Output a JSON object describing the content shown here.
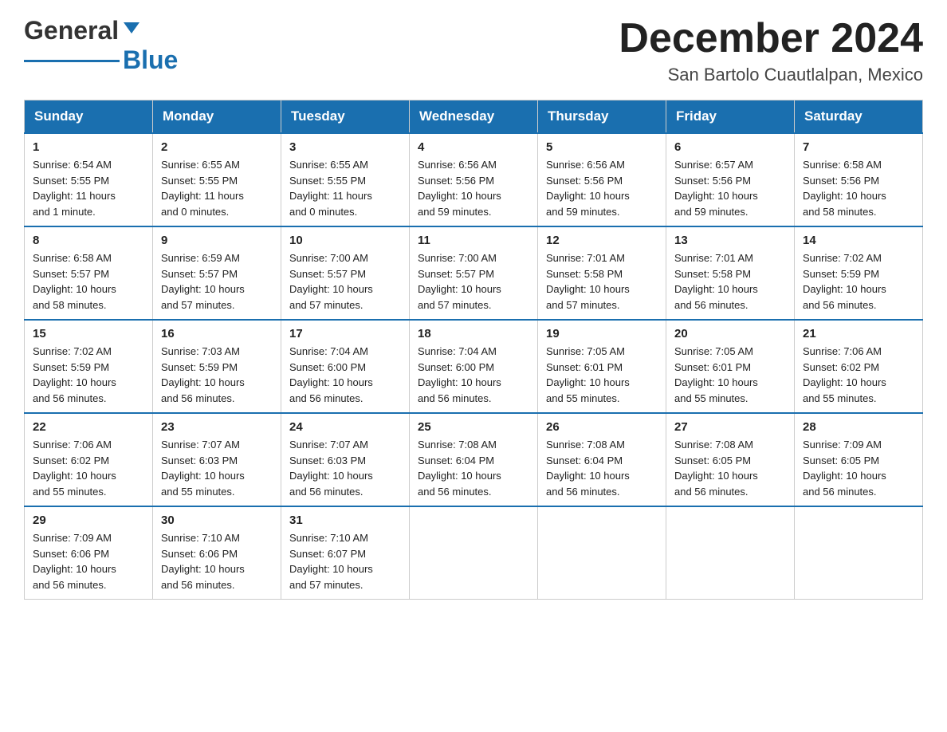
{
  "logo": {
    "general": "General",
    "blue": "Blue"
  },
  "title": {
    "month": "December 2024",
    "location": "San Bartolo Cuautlalpan, Mexico"
  },
  "headers": [
    "Sunday",
    "Monday",
    "Tuesday",
    "Wednesday",
    "Thursday",
    "Friday",
    "Saturday"
  ],
  "weeks": [
    [
      {
        "day": "1",
        "info": "Sunrise: 6:54 AM\nSunset: 5:55 PM\nDaylight: 11 hours\nand 1 minute."
      },
      {
        "day": "2",
        "info": "Sunrise: 6:55 AM\nSunset: 5:55 PM\nDaylight: 11 hours\nand 0 minutes."
      },
      {
        "day": "3",
        "info": "Sunrise: 6:55 AM\nSunset: 5:55 PM\nDaylight: 11 hours\nand 0 minutes."
      },
      {
        "day": "4",
        "info": "Sunrise: 6:56 AM\nSunset: 5:56 PM\nDaylight: 10 hours\nand 59 minutes."
      },
      {
        "day": "5",
        "info": "Sunrise: 6:56 AM\nSunset: 5:56 PM\nDaylight: 10 hours\nand 59 minutes."
      },
      {
        "day": "6",
        "info": "Sunrise: 6:57 AM\nSunset: 5:56 PM\nDaylight: 10 hours\nand 59 minutes."
      },
      {
        "day": "7",
        "info": "Sunrise: 6:58 AM\nSunset: 5:56 PM\nDaylight: 10 hours\nand 58 minutes."
      }
    ],
    [
      {
        "day": "8",
        "info": "Sunrise: 6:58 AM\nSunset: 5:57 PM\nDaylight: 10 hours\nand 58 minutes."
      },
      {
        "day": "9",
        "info": "Sunrise: 6:59 AM\nSunset: 5:57 PM\nDaylight: 10 hours\nand 57 minutes."
      },
      {
        "day": "10",
        "info": "Sunrise: 7:00 AM\nSunset: 5:57 PM\nDaylight: 10 hours\nand 57 minutes."
      },
      {
        "day": "11",
        "info": "Sunrise: 7:00 AM\nSunset: 5:57 PM\nDaylight: 10 hours\nand 57 minutes."
      },
      {
        "day": "12",
        "info": "Sunrise: 7:01 AM\nSunset: 5:58 PM\nDaylight: 10 hours\nand 57 minutes."
      },
      {
        "day": "13",
        "info": "Sunrise: 7:01 AM\nSunset: 5:58 PM\nDaylight: 10 hours\nand 56 minutes."
      },
      {
        "day": "14",
        "info": "Sunrise: 7:02 AM\nSunset: 5:59 PM\nDaylight: 10 hours\nand 56 minutes."
      }
    ],
    [
      {
        "day": "15",
        "info": "Sunrise: 7:02 AM\nSunset: 5:59 PM\nDaylight: 10 hours\nand 56 minutes."
      },
      {
        "day": "16",
        "info": "Sunrise: 7:03 AM\nSunset: 5:59 PM\nDaylight: 10 hours\nand 56 minutes."
      },
      {
        "day": "17",
        "info": "Sunrise: 7:04 AM\nSunset: 6:00 PM\nDaylight: 10 hours\nand 56 minutes."
      },
      {
        "day": "18",
        "info": "Sunrise: 7:04 AM\nSunset: 6:00 PM\nDaylight: 10 hours\nand 56 minutes."
      },
      {
        "day": "19",
        "info": "Sunrise: 7:05 AM\nSunset: 6:01 PM\nDaylight: 10 hours\nand 55 minutes."
      },
      {
        "day": "20",
        "info": "Sunrise: 7:05 AM\nSunset: 6:01 PM\nDaylight: 10 hours\nand 55 minutes."
      },
      {
        "day": "21",
        "info": "Sunrise: 7:06 AM\nSunset: 6:02 PM\nDaylight: 10 hours\nand 55 minutes."
      }
    ],
    [
      {
        "day": "22",
        "info": "Sunrise: 7:06 AM\nSunset: 6:02 PM\nDaylight: 10 hours\nand 55 minutes."
      },
      {
        "day": "23",
        "info": "Sunrise: 7:07 AM\nSunset: 6:03 PM\nDaylight: 10 hours\nand 55 minutes."
      },
      {
        "day": "24",
        "info": "Sunrise: 7:07 AM\nSunset: 6:03 PM\nDaylight: 10 hours\nand 56 minutes."
      },
      {
        "day": "25",
        "info": "Sunrise: 7:08 AM\nSunset: 6:04 PM\nDaylight: 10 hours\nand 56 minutes."
      },
      {
        "day": "26",
        "info": "Sunrise: 7:08 AM\nSunset: 6:04 PM\nDaylight: 10 hours\nand 56 minutes."
      },
      {
        "day": "27",
        "info": "Sunrise: 7:08 AM\nSunset: 6:05 PM\nDaylight: 10 hours\nand 56 minutes."
      },
      {
        "day": "28",
        "info": "Sunrise: 7:09 AM\nSunset: 6:05 PM\nDaylight: 10 hours\nand 56 minutes."
      }
    ],
    [
      {
        "day": "29",
        "info": "Sunrise: 7:09 AM\nSunset: 6:06 PM\nDaylight: 10 hours\nand 56 minutes."
      },
      {
        "day": "30",
        "info": "Sunrise: 7:10 AM\nSunset: 6:06 PM\nDaylight: 10 hours\nand 56 minutes."
      },
      {
        "day": "31",
        "info": "Sunrise: 7:10 AM\nSunset: 6:07 PM\nDaylight: 10 hours\nand 57 minutes."
      },
      null,
      null,
      null,
      null
    ]
  ]
}
